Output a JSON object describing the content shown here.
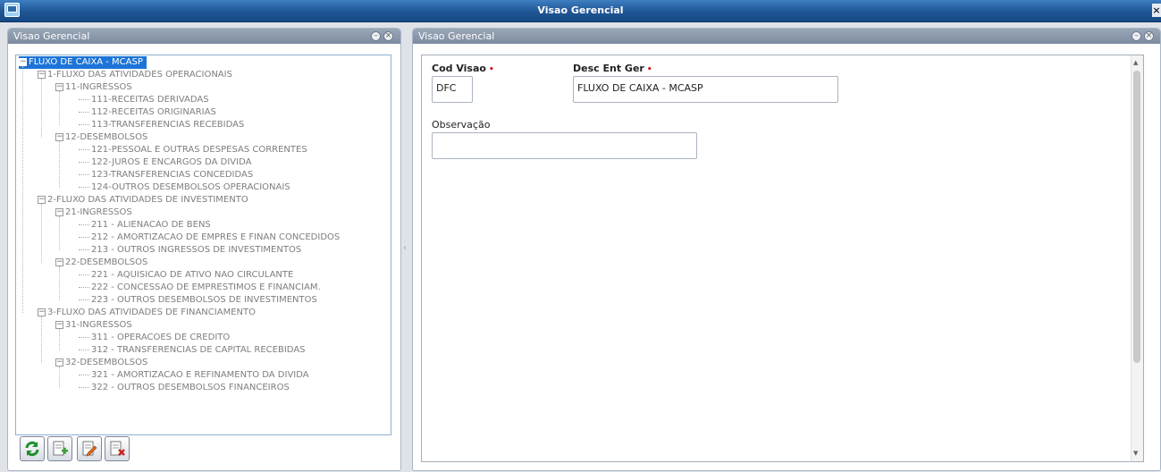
{
  "window": {
    "title": "Visao Gerencial"
  },
  "left_panel": {
    "title": "Visao Gerencial",
    "tree": [
      {
        "label": "FLUXO DE CAIXA - MCASP",
        "level": 0,
        "expanded": true,
        "selected": true
      },
      {
        "label": "1-FLUXO DAS ATIVIDADES OPERACIONAIS",
        "level": 1,
        "expanded": true
      },
      {
        "label": "11-INGRESSOS",
        "level": 2,
        "expanded": true
      },
      {
        "label": "111-RECEITAS DERIVADAS",
        "level": 3
      },
      {
        "label": "112-RECEITAS ORIGINARIAS",
        "level": 3
      },
      {
        "label": "113-TRANSFERENCIAS RECEBIDAS",
        "level": 3
      },
      {
        "label": "12-DESEMBOLSOS",
        "level": 2,
        "expanded": true
      },
      {
        "label": "121-PESSOAL E OUTRAS DESPESAS CORRENTES",
        "level": 3
      },
      {
        "label": "122-JUROS E ENCARGOS DA DIVIDA",
        "level": 3
      },
      {
        "label": "123-TRANSFERENCIAS CONCEDIDAS",
        "level": 3
      },
      {
        "label": "124-OUTROS DESEMBOLSOS OPERACIONAIS",
        "level": 3
      },
      {
        "label": "2-FLUXO DAS ATIVIDADES DE INVESTIMENTO",
        "level": 1,
        "expanded": true
      },
      {
        "label": "21-INGRESSOS",
        "level": 2,
        "expanded": true
      },
      {
        "label": "211 - ALIENACAO DE BENS",
        "level": 3
      },
      {
        "label": "212 - AMORTIZACAO DE EMPRES E FINAN CONCEDIDOS",
        "level": 3
      },
      {
        "label": "213 - OUTROS INGRESSOS DE INVESTIMENTOS",
        "level": 3
      },
      {
        "label": "22-DESEMBOLSOS",
        "level": 2,
        "expanded": true
      },
      {
        "label": "221 - AQUISICAO DE ATIVO NAO CIRCULANTE",
        "level": 3
      },
      {
        "label": "222 - CONCESSAO DE EMPRESTIMOS E FINANCIAM.",
        "level": 3
      },
      {
        "label": "223 - OUTROS DESEMBOLSOS DE INVESTIMENTOS",
        "level": 3
      },
      {
        "label": "3-FLUXO DAS ATIVIDADES DE FINANCIAMENTO",
        "level": 1,
        "expanded": true
      },
      {
        "label": "31-INGRESSOS",
        "level": 2,
        "expanded": true
      },
      {
        "label": "311 - OPERACOES DE CREDITO",
        "level": 3
      },
      {
        "label": "312 - TRANSFERENCIAS DE CAPITAL RECEBIDAS",
        "level": 3
      },
      {
        "label": "32-DESEMBOLSOS",
        "level": 2,
        "expanded": true
      },
      {
        "label": "321 - AMORTIZACAO E REFINAMENTO DA DIVIDA",
        "level": 3
      },
      {
        "label": "322 - OUTROS DESEMBOLSOS FINANCEIROS",
        "level": 3
      }
    ],
    "toolbar": [
      "refresh-icon",
      "add-record-icon",
      "edit-record-icon",
      "delete-record-icon"
    ]
  },
  "right_panel": {
    "title": "Visao Gerencial",
    "form": {
      "cod_visao_label": "Cod Visao",
      "cod_visao_value": "DFC",
      "desc_label": "Desc Ent Ger",
      "desc_value": "FLUXO DE CAIXA - MCASP",
      "obs_label": "Observação",
      "obs_value": "",
      "required_marker": "•"
    }
  },
  "colors": {
    "titlebar": "#1f5594",
    "panel_header": "#8a97aa",
    "selection": "#1c74d8",
    "required": "#dd0000"
  }
}
